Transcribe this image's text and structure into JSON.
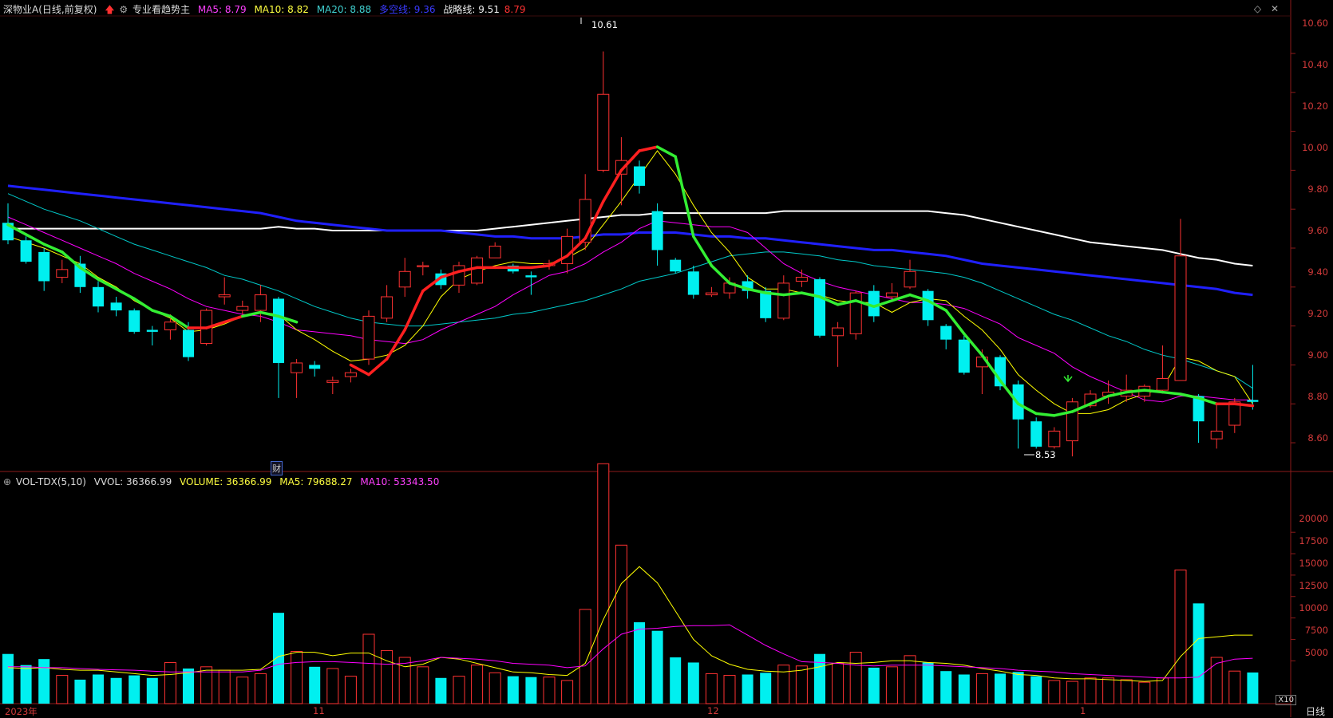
{
  "stock": {
    "name": "深物业A",
    "mode": "(日线,前复权)",
    "indicator_name": "专业看趋势主",
    "ma5_label": "MA5: 8.79",
    "ma10_label": "MA10: 8.82",
    "ma20_label": "MA20: 8.88",
    "duokong_label": "多空线: 9.36",
    "zhanlue_label": "战略线: 9.51",
    "last_price": "8.79"
  },
  "volume_header": {
    "name": "VOL-TDX(5,10)",
    "vvol_label": "VVOL: 36366.99",
    "volume_label": "VOLUME: 36366.99",
    "ma5_label": "MA5: 79688.27",
    "ma10_label": "MA10: 53343.50"
  },
  "price_axis": [
    "10.60",
    "10.40",
    "10.20",
    "10.00",
    "9.80",
    "9.60",
    "9.40",
    "9.20",
    "9.00",
    "8.80",
    "8.60"
  ],
  "volume_axis": [
    "20000",
    "17500",
    "15000",
    "12500",
    "10000",
    "7500",
    "5000"
  ],
  "x_axis": [
    "2023年",
    "11",
    "12",
    "1"
  ],
  "annotations": {
    "high": "10.61",
    "low": "8.53",
    "finance_tag": "财",
    "scale_tag": "X10"
  },
  "period_button": "日线",
  "colors": {
    "up": "#ff3232",
    "down": "#00f0f0",
    "ma5": "#ffff00",
    "ma10": "#ff00ff",
    "ma20": "#00c8c8",
    "duokong": "#2020ff",
    "zhanlue": "#ffffff",
    "trend_up": "#ff2020",
    "trend_down": "#33ee33"
  },
  "chart_data": {
    "type": "candlestick",
    "candles": [
      [
        9.73,
        9.64,
        9.83,
        9.62,
        5800
      ],
      [
        9.64,
        9.53,
        9.66,
        9.52,
        4500
      ],
      [
        9.58,
        9.43,
        9.6,
        9.38,
        5200
      ],
      [
        9.45,
        9.49,
        9.54,
        9.42,
        3300
      ],
      [
        9.52,
        9.4,
        9.56,
        9.37,
        2800
      ],
      [
        9.4,
        9.3,
        9.43,
        9.27,
        3400
      ],
      [
        9.32,
        9.28,
        9.35,
        9.25,
        3000
      ],
      [
        9.28,
        9.17,
        9.29,
        9.16,
        3300
      ],
      [
        9.18,
        9.17,
        9.2,
        9.1,
        3000
      ],
      [
        9.18,
        9.22,
        9.26,
        9.13,
        4800
      ],
      [
        9.18,
        9.04,
        9.22,
        9.02,
        4100
      ],
      [
        9.11,
        9.28,
        9.29,
        9.1,
        4300
      ],
      [
        9.35,
        9.36,
        9.45,
        9.31,
        3900
      ],
      [
        9.28,
        9.3,
        9.33,
        9.26,
        3100
      ],
      [
        9.28,
        9.36,
        9.41,
        9.22,
        3500
      ],
      [
        9.34,
        9.01,
        9.35,
        8.83,
        10600
      ],
      [
        8.96,
        9.01,
        9.03,
        8.83,
        6100
      ],
      [
        9.0,
        8.98,
        9.02,
        8.94,
        4300
      ],
      [
        8.91,
        8.92,
        8.94,
        8.85,
        4100
      ],
      [
        8.94,
        8.96,
        8.98,
        8.91,
        3200
      ],
      [
        9.03,
        9.25,
        9.28,
        9.0,
        8100
      ],
      [
        9.24,
        9.35,
        9.41,
        9.22,
        6200
      ],
      [
        9.4,
        9.48,
        9.55,
        9.35,
        5400
      ],
      [
        9.51,
        9.51,
        9.53,
        9.46,
        4300
      ],
      [
        9.47,
        9.41,
        9.49,
        9.39,
        3000
      ],
      [
        9.41,
        9.51,
        9.53,
        9.37,
        3200
      ],
      [
        9.42,
        9.55,
        9.56,
        9.41,
        4500
      ],
      [
        9.55,
        9.61,
        9.63,
        9.55,
        3600
      ],
      [
        9.51,
        9.48,
        9.52,
        9.47,
        3200
      ],
      [
        9.46,
        9.45,
        9.48,
        9.36,
        3100
      ],
      [
        9.51,
        9.52,
        9.54,
        9.49,
        3100
      ],
      [
        9.52,
        9.66,
        9.7,
        9.47,
        2700
      ],
      [
        9.63,
        9.85,
        9.98,
        9.59,
        11000
      ],
      [
        10.0,
        10.39,
        10.61,
        9.99,
        28000
      ],
      [
        9.98,
        10.05,
        10.17,
        9.82,
        18500
      ],
      [
        10.02,
        9.92,
        10.05,
        9.88,
        9500
      ],
      [
        9.79,
        9.59,
        9.83,
        9.51,
        8500
      ],
      [
        9.54,
        9.48,
        9.55,
        9.47,
        5400
      ],
      [
        9.48,
        9.36,
        9.51,
        9.34,
        4800
      ],
      [
        9.36,
        9.37,
        9.4,
        9.35,
        3500
      ],
      [
        9.37,
        9.42,
        9.45,
        9.34,
        3300
      ],
      [
        9.43,
        9.38,
        9.46,
        9.34,
        3400
      ],
      [
        9.38,
        9.24,
        9.4,
        9.22,
        3600
      ],
      [
        9.24,
        9.42,
        9.46,
        9.23,
        4500
      ],
      [
        9.43,
        9.45,
        9.49,
        9.4,
        4400
      ],
      [
        9.44,
        9.15,
        9.45,
        9.14,
        5800
      ],
      [
        9.15,
        9.19,
        9.22,
        8.99,
        4700
      ],
      [
        9.16,
        9.37,
        9.38,
        9.13,
        6000
      ],
      [
        9.38,
        9.25,
        9.41,
        9.22,
        4200
      ],
      [
        9.35,
        9.37,
        9.42,
        9.34,
        4300
      ],
      [
        9.4,
        9.48,
        9.54,
        9.39,
        5600
      ],
      [
        9.38,
        9.23,
        9.39,
        9.2,
        4800
      ],
      [
        9.2,
        9.13,
        9.21,
        9.08,
        3800
      ],
      [
        9.13,
        8.96,
        9.15,
        8.95,
        3400
      ],
      [
        8.99,
        9.04,
        9.08,
        8.85,
        3500
      ],
      [
        9.04,
        8.89,
        9.05,
        8.87,
        3500
      ],
      [
        8.9,
        8.72,
        8.92,
        8.57,
        3700
      ],
      [
        8.71,
        8.58,
        8.73,
        8.57,
        3200
      ],
      [
        8.58,
        8.66,
        8.68,
        8.57,
        2700
      ],
      [
        8.61,
        8.81,
        8.83,
        8.53,
        2600
      ],
      [
        8.79,
        8.85,
        8.87,
        8.78,
        3000
      ],
      [
        8.84,
        8.86,
        8.92,
        8.8,
        3000
      ],
      [
        8.84,
        8.87,
        8.95,
        8.81,
        2800
      ],
      [
        8.84,
        8.89,
        8.9,
        8.81,
        2500
      ],
      [
        8.87,
        8.93,
        9.1,
        8.86,
        3000
      ],
      [
        8.92,
        9.56,
        9.75,
        8.92,
        15600
      ],
      [
        8.84,
        8.71,
        8.85,
        8.6,
        11700
      ],
      [
        8.62,
        8.66,
        8.8,
        8.57,
        5400
      ],
      [
        8.69,
        8.81,
        8.83,
        8.65,
        3800
      ],
      [
        8.82,
        8.81,
        9.0,
        8.77,
        3636.7
      ]
    ],
    "ma5": [
      9.66,
      9.63,
      9.6,
      9.56,
      9.52,
      9.45,
      9.4,
      9.33,
      9.28,
      9.24,
      9.17,
      9.18,
      9.21,
      9.25,
      9.27,
      9.26,
      9.18,
      9.13,
      9.07,
      9.02,
      9.03,
      9.05,
      9.1,
      9.2,
      9.35,
      9.44,
      9.48,
      9.51,
      9.53,
      9.52,
      9.52,
      9.55,
      9.6,
      9.72,
      9.84,
      9.97,
      10.1,
      9.98,
      9.82,
      9.68,
      9.58,
      9.45,
      9.39,
      9.39,
      9.37,
      9.36,
      9.33,
      9.32,
      9.32,
      9.27,
      9.32,
      9.34,
      9.33,
      9.25,
      9.18,
      9.08,
      8.95,
      8.87,
      8.8,
      8.75,
      8.75,
      8.77,
      8.82,
      8.85,
      8.88,
      9.04,
      9.02,
      8.97,
      8.94,
      8.8
    ],
    "ma10": [
      9.76,
      9.72,
      9.68,
      9.64,
      9.6,
      9.56,
      9.52,
      9.47,
      9.43,
      9.39,
      9.34,
      9.3,
      9.28,
      9.26,
      9.25,
      9.22,
      9.18,
      9.17,
      9.16,
      9.15,
      9.13,
      9.12,
      9.11,
      9.13,
      9.18,
      9.22,
      9.26,
      9.3,
      9.36,
      9.41,
      9.46,
      9.48,
      9.52,
      9.58,
      9.63,
      9.7,
      9.74,
      9.73,
      9.72,
      9.71,
      9.71,
      9.68,
      9.6,
      9.52,
      9.47,
      9.43,
      9.4,
      9.38,
      9.36,
      9.34,
      9.32,
      9.32,
      9.31,
      9.29,
      9.25,
      9.21,
      9.14,
      9.1,
      9.06,
      8.99,
      8.94,
      8.9,
      8.86,
      8.82,
      8.81,
      8.84,
      8.84,
      8.83,
      8.82,
      8.82
    ],
    "ma20": [
      9.88,
      9.84,
      9.8,
      9.77,
      9.74,
      9.7,
      9.66,
      9.62,
      9.59,
      9.56,
      9.53,
      9.5,
      9.46,
      9.44,
      9.41,
      9.38,
      9.34,
      9.3,
      9.27,
      9.24,
      9.22,
      9.21,
      9.2,
      9.2,
      9.21,
      9.22,
      9.23,
      9.24,
      9.26,
      9.27,
      9.29,
      9.31,
      9.33,
      9.36,
      9.39,
      9.43,
      9.45,
      9.47,
      9.5,
      9.53,
      9.56,
      9.57,
      9.58,
      9.58,
      9.57,
      9.56,
      9.54,
      9.53,
      9.51,
      9.5,
      9.49,
      9.48,
      9.47,
      9.45,
      9.42,
      9.38,
      9.34,
      9.3,
      9.26,
      9.23,
      9.19,
      9.15,
      9.12,
      9.08,
      9.05,
      9.03,
      9.0,
      8.97,
      8.94,
      8.88
    ],
    "duokong": [
      9.92,
      9.91,
      9.9,
      9.89,
      9.88,
      9.87,
      9.86,
      9.85,
      9.84,
      9.83,
      9.82,
      9.81,
      9.8,
      9.79,
      9.78,
      9.76,
      9.74,
      9.73,
      9.72,
      9.71,
      9.7,
      9.69,
      9.69,
      9.69,
      9.69,
      9.68,
      9.67,
      9.66,
      9.66,
      9.65,
      9.65,
      9.65,
      9.66,
      9.67,
      9.67,
      9.68,
      9.68,
      9.68,
      9.67,
      9.66,
      9.66,
      9.65,
      9.65,
      9.64,
      9.63,
      9.62,
      9.61,
      9.6,
      9.59,
      9.59,
      9.58,
      9.57,
      9.56,
      9.54,
      9.52,
      9.51,
      9.5,
      9.49,
      9.48,
      9.47,
      9.46,
      9.45,
      9.44,
      9.43,
      9.42,
      9.41,
      9.4,
      9.39,
      9.37,
      9.36
    ],
    "zhanlue": [
      9.7,
      9.7,
      9.7,
      9.7,
      9.7,
      9.7,
      9.7,
      9.7,
      9.7,
      9.7,
      9.7,
      9.7,
      9.7,
      9.7,
      9.7,
      9.71,
      9.7,
      9.7,
      9.69,
      9.69,
      9.69,
      9.69,
      9.69,
      9.69,
      9.69,
      9.69,
      9.69,
      9.7,
      9.71,
      9.72,
      9.73,
      9.74,
      9.75,
      9.76,
      9.77,
      9.77,
      9.78,
      9.78,
      9.78,
      9.78,
      9.78,
      9.78,
      9.78,
      9.79,
      9.79,
      9.79,
      9.79,
      9.79,
      9.79,
      9.79,
      9.79,
      9.79,
      9.78,
      9.77,
      9.75,
      9.73,
      9.71,
      9.69,
      9.67,
      9.65,
      9.63,
      9.62,
      9.61,
      9.6,
      9.59,
      9.57,
      9.55,
      9.54,
      9.52,
      9.51
    ],
    "trend": [
      9.72,
      9.67,
      9.62,
      9.58,
      9.5,
      9.44,
      9.39,
      9.34,
      9.28,
      9.25,
      9.19,
      9.19,
      9.22,
      9.25,
      9.27,
      9.25,
      9.22,
      null,
      null,
      9.0,
      8.95,
      9.03,
      9.18,
      9.38,
      9.45,
      9.48,
      9.5,
      9.5,
      9.5,
      9.5,
      9.51,
      9.56,
      9.65,
      9.84,
      10.0,
      10.1,
      10.12,
      10.07,
      9.66,
      9.51,
      9.42,
      9.39,
      9.37,
      9.36,
      9.37,
      9.35,
      9.31,
      9.33,
      9.3,
      9.33,
      9.36,
      9.33,
      9.28,
      9.16,
      9.05,
      8.92,
      8.8,
      8.75,
      8.74,
      8.76,
      8.8,
      8.84,
      8.86,
      8.87,
      8.86,
      8.85,
      8.83,
      8.8,
      8.8,
      8.79
    ],
    "trend_dir": [
      "d",
      "d",
      "d",
      "d",
      "d",
      "d",
      "d",
      "d",
      "d",
      "d",
      "d",
      "u",
      "u",
      "u",
      "d",
      "d",
      "d",
      "d",
      "d",
      "u",
      "u",
      "u",
      "u",
      "u",
      "u",
      "u",
      "u",
      "u",
      "u",
      "u",
      "u",
      "u",
      "u",
      "u",
      "u",
      "u",
      "u",
      "d",
      "d",
      "d",
      "d",
      "d",
      "d",
      "d",
      "d",
      "d",
      "d",
      "d",
      "d",
      "d",
      "d",
      "d",
      "d",
      "d",
      "d",
      "d",
      "d",
      "d",
      "d",
      "d",
      "d",
      "d",
      "d",
      "d",
      "d",
      "d",
      "d",
      "d",
      "u",
      "u"
    ],
    "vol_ma5": [
      4200,
      4100,
      4200,
      4000,
      3900,
      3900,
      3700,
      3500,
      3300,
      3400,
      3600,
      3900,
      3900,
      3900,
      4000,
      5500,
      6000,
      6000,
      5600,
      5900,
      5900,
      5000,
      4300,
      4600,
      5400,
      5200,
      4700,
      4200,
      3700,
      3600,
      3400,
      3300,
      4700,
      9800,
      14000,
      16000,
      14100,
      10800,
      7500,
      5600,
      4600,
      4000,
      3800,
      3700,
      3900,
      4300,
      4800,
      4700,
      4800,
      5000,
      5000,
      4800,
      4700,
      4500,
      4100,
      3800,
      3400,
      3300,
      3000,
      2900,
      2900,
      2800,
      2700,
      2600,
      2700,
      5500,
      7600,
      7800,
      8000,
      8000
    ],
    "vol_ma10": [
      4300,
      4300,
      4200,
      4200,
      4100,
      4000,
      3950,
      3900,
      3800,
      3700,
      3700,
      3700,
      3700,
      3700,
      3900,
      4600,
      4800,
      4900,
      4900,
      4800,
      4700,
      4600,
      4700,
      5000,
      5400,
      5300,
      5200,
      5000,
      4700,
      4600,
      4500,
      4200,
      4400,
      6400,
      8100,
      8700,
      8800,
      9000,
      9100,
      9100,
      9200,
      8000,
      6800,
      5800,
      4900,
      4800,
      4700,
      4500,
      4400,
      4500,
      4500,
      4500,
      4400,
      4300,
      4200,
      4100,
      3900,
      3800,
      3700,
      3500,
      3400,
      3300,
      3200,
      3100,
      3000,
      3000,
      3100,
      4700,
      5200,
      5300
    ]
  }
}
